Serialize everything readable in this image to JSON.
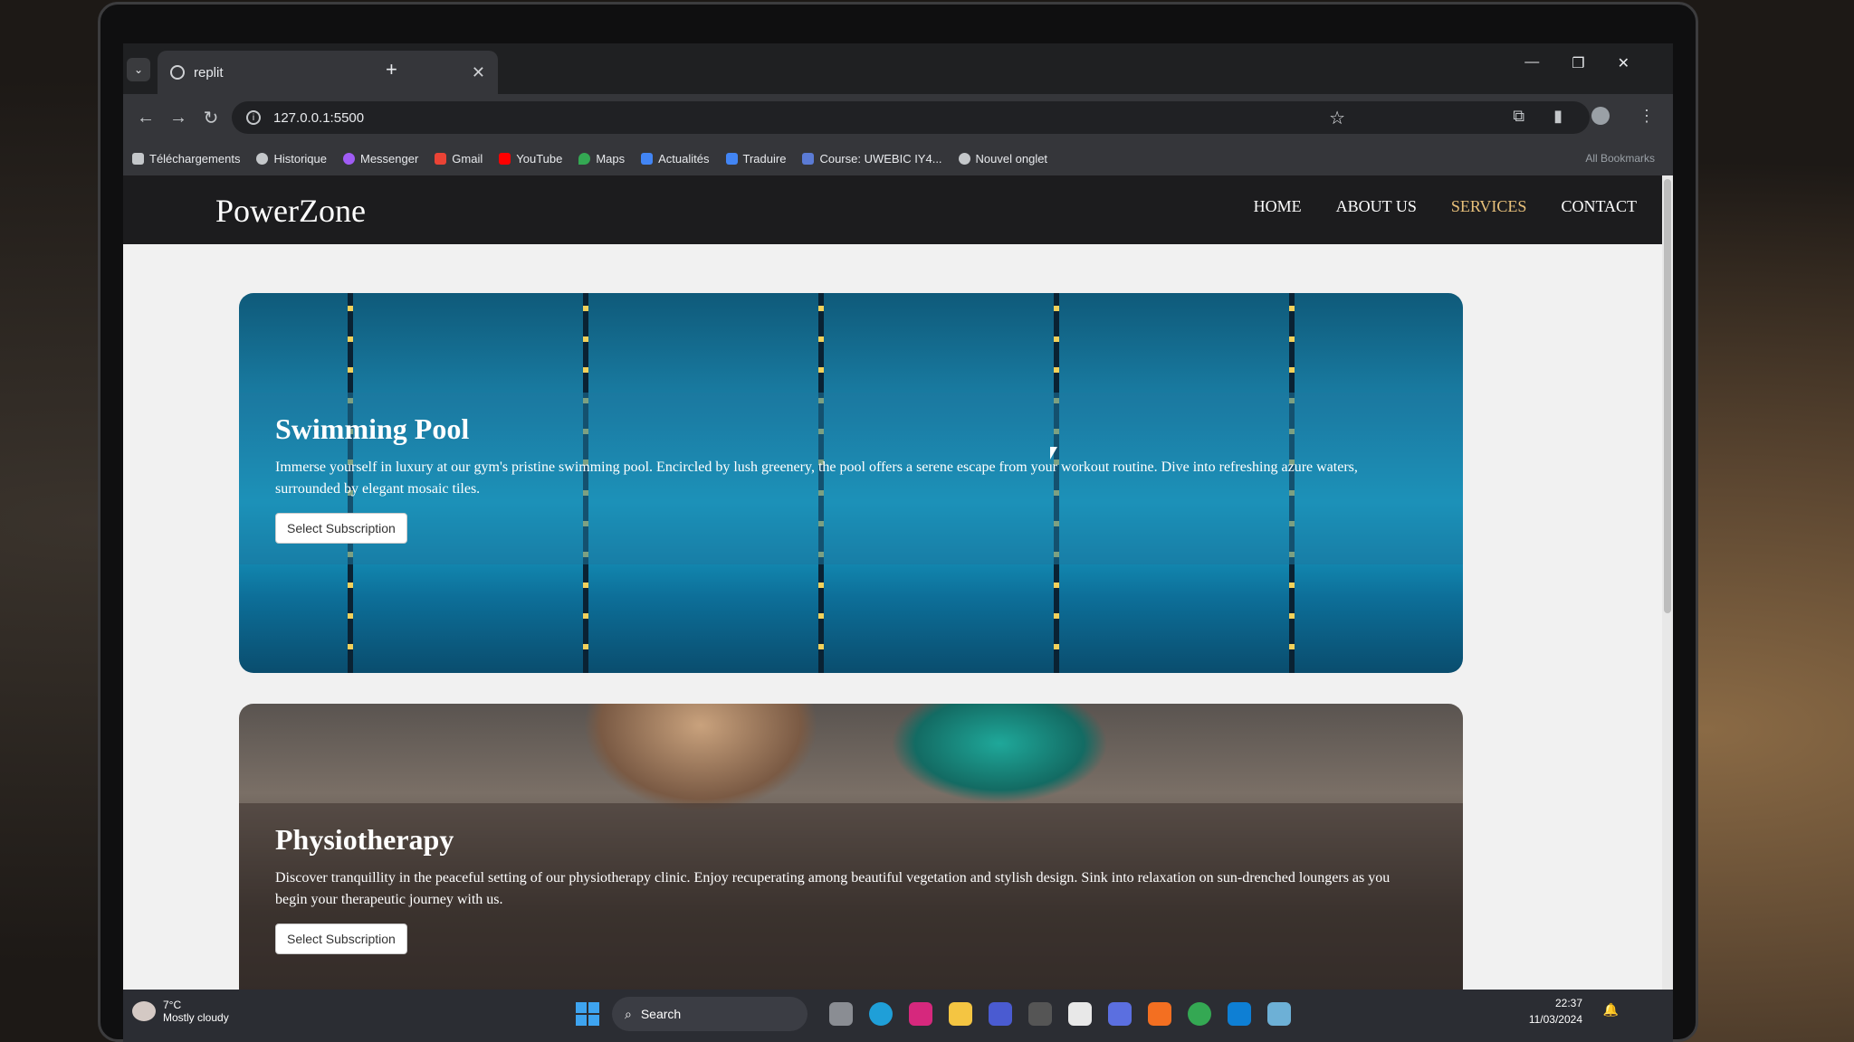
{
  "browser": {
    "tab_title": "replit",
    "url": "127.0.0.1:5500",
    "bookmarks": [
      {
        "label": "Téléchargements",
        "icon": "download-icon",
        "color": "#c4c7ca"
      },
      {
        "label": "Historique",
        "icon": "history-icon",
        "color": "#c4c7ca"
      },
      {
        "label": "Messenger",
        "icon": "messenger-icon",
        "color": "#a05cf5"
      },
      {
        "label": "Gmail",
        "icon": "gmail-icon",
        "color": "#ea4335"
      },
      {
        "label": "YouTube",
        "icon": "youtube-icon",
        "color": "#ff0000"
      },
      {
        "label": "Maps",
        "icon": "maps-icon",
        "color": "#34a853"
      },
      {
        "label": "Actualités",
        "icon": "news-icon",
        "color": "#4285f4"
      },
      {
        "label": "Traduire",
        "icon": "translate-icon",
        "color": "#4285f4"
      },
      {
        "label": "Course: UWEBIC IY4...",
        "icon": "course-icon",
        "color": "#5b7bd5"
      },
      {
        "label": "Nouvel onglet",
        "icon": "globe-icon",
        "color": "#c4c7ca"
      }
    ],
    "all_bookmarks": "All Bookmarks"
  },
  "site": {
    "logo": "PowerZone",
    "menu": {
      "home": "HOME",
      "about": "ABOUT US",
      "services": "SERVICES",
      "contact": "CONTACT"
    },
    "cards": [
      {
        "title": "Swimming Pool",
        "text": "Immerse yourself in luxury at our gym's pristine swimming pool. Encircled by lush greenery, the pool offers a serene escape from your workout routine. Dive into refreshing azure waters, surrounded by elegant mosaic tiles.",
        "button": "Select Subscription"
      },
      {
        "title": "Physiotherapy",
        "text": "Discover tranquillity in the peaceful setting of our physiotherapy clinic. Enjoy recuperating among beautiful vegetation and stylish design. Sink into relaxation on sun-drenched loungers as you begin your therapeutic journey with us.",
        "button": "Select Subscription"
      }
    ]
  },
  "taskbar": {
    "temperature": "7°C",
    "weather": "Mostly cloudy",
    "search": "Search",
    "time": "22:37",
    "date": "11/03/2024"
  }
}
